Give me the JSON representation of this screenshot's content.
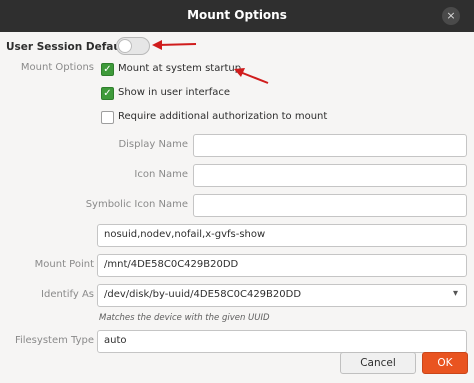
{
  "window": {
    "title": "Mount Options",
    "close_glyph": "×"
  },
  "user_session": {
    "label": "User Session Defaults",
    "enabled": false
  },
  "mount_options": {
    "label": "Mount Options",
    "checkboxes": [
      {
        "label": "Mount at system startup",
        "checked": true,
        "check_glyph": "✓"
      },
      {
        "label": "Show in user interface",
        "checked": true,
        "check_glyph": "✓"
      },
      {
        "label": "Require additional authorization to mount",
        "checked": false,
        "check_glyph": ""
      }
    ]
  },
  "fields": {
    "display_name": {
      "label": "Display Name",
      "value": ""
    },
    "icon_name": {
      "label": "Icon Name",
      "value": ""
    },
    "symbolic_icon_name": {
      "label": "Symbolic Icon Name",
      "value": ""
    },
    "options_string": {
      "value": "nosuid,nodev,nofail,x-gvfs-show"
    },
    "mount_point": {
      "label": "Mount Point",
      "value": "/mnt/4DE58C0C429B20DD"
    },
    "identify_as": {
      "label": "Identify As",
      "value": "/dev/disk/by-uuid/4DE58C0C429B20DD",
      "hint": "Matches the device with the given UUID"
    },
    "filesystem_type": {
      "label": "Filesystem Type",
      "value": "auto"
    }
  },
  "buttons": {
    "cancel": "Cancel",
    "ok": "OK"
  },
  "colors": {
    "checkbox_green": "#3e9a3a",
    "ok_orange": "#e95420",
    "annotation_red": "#d01c1c"
  }
}
